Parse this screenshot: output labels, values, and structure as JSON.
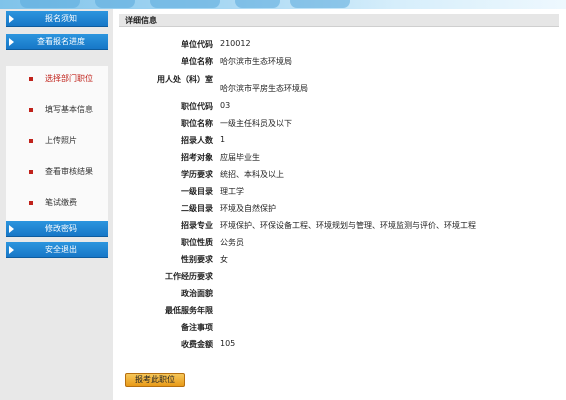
{
  "colors": {
    "nav_blue": "#1e86d3",
    "active_red": "#c0221b",
    "button_orange": "#f0a52b",
    "sidebar_bg": "#e8e8e8"
  },
  "sidebar": {
    "top_buttons": [
      {
        "label": "报名须知"
      },
      {
        "label": "查看报名进度"
      }
    ],
    "submenu": [
      {
        "label": "选择部门职位",
        "active": true
      },
      {
        "label": "填写基本信息",
        "active": false
      },
      {
        "label": "上传照片",
        "active": false
      },
      {
        "label": "查看审核结果",
        "active": false
      },
      {
        "label": "笔试缴费",
        "active": false
      }
    ],
    "bottom_buttons": [
      {
        "label": "修改密码"
      },
      {
        "label": "安全退出"
      }
    ]
  },
  "main": {
    "tab_title": "详细信息",
    "fields": [
      {
        "label": "单位代码",
        "value": "210012"
      },
      {
        "label": "单位名称",
        "value": "哈尔滨市生态环境局"
      },
      {
        "label": "用人处（科）室",
        "value": "哈尔滨市平房生态环境局"
      },
      {
        "label": "职位代码",
        "value": "03"
      },
      {
        "label": "职位名称",
        "value": "一级主任科员及以下"
      },
      {
        "label": "招录人数",
        "value": "1"
      },
      {
        "label": "招考对象",
        "value": "应届毕业生"
      },
      {
        "label": "学历要求",
        "value": "统招、本科及以上"
      },
      {
        "label": "一级目录",
        "value": "理工学"
      },
      {
        "label": "二级目录",
        "value": "环境及自然保护"
      },
      {
        "label": "招录专业",
        "value": "环境保护、环保设备工程、环境规划与管理、环境监测与评价、环境工程"
      },
      {
        "label": "职位性质",
        "value": "公务员"
      },
      {
        "label": "性别要求",
        "value": "女"
      },
      {
        "label": "工作经历要求",
        "value": ""
      },
      {
        "label": "政治面貌",
        "value": ""
      },
      {
        "label": "最低服务年限",
        "value": ""
      },
      {
        "label": "备注事项",
        "value": ""
      },
      {
        "label": "收费金额",
        "value": "105"
      }
    ],
    "apply_button": "报考此职位"
  }
}
